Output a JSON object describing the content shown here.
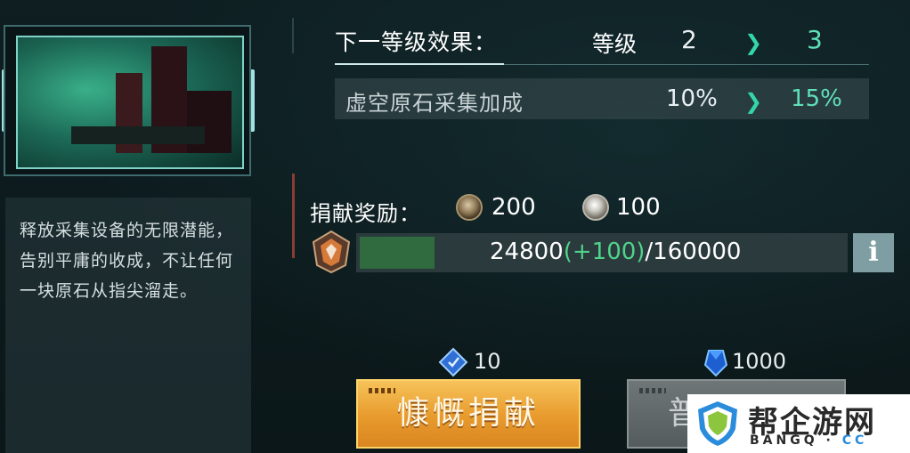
{
  "card": {
    "description": "释放采集设备的无限潜能，告别平庸的收成，不让任何一块原石从指尖溜走。"
  },
  "next_level": {
    "title": "下一等级效果：",
    "level_label": "等级",
    "current_level": "2",
    "next_level": "3",
    "effect_name": "虚空原石采集加成",
    "effect_current": "10%",
    "effect_next": "15%"
  },
  "reward": {
    "label": "捐献奖励：",
    "coin1_icon": "bronze-coin-icon",
    "coin1_value": "200",
    "coin2_icon": "silver-coin-icon",
    "coin2_value": "100"
  },
  "progress": {
    "current": "24800",
    "plus": "(+100)",
    "total": "/160000",
    "fraction": 0.155
  },
  "buttons": {
    "generous_cost": "10",
    "generous_label": "慷慨捐献",
    "normal_cost": "1000",
    "normal_label": "普"
  },
  "watermark": {
    "cn": "帮企游网",
    "en_left": "BANGQ · ",
    "en_right": "CC"
  },
  "colors": {
    "accent_green": "#5fe0b8",
    "gold_button": "#e89a2c",
    "progress_fill": "#2f6b3f"
  }
}
